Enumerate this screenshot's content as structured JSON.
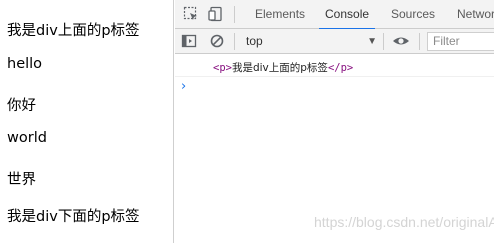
{
  "page": {
    "lines": [
      "我是div上面的p标签",
      "hello",
      "你好",
      "world",
      "世界",
      "我是div下面的p标签"
    ]
  },
  "devtools": {
    "tabs": [
      "Elements",
      "Console",
      "Sources",
      "Network"
    ],
    "active_tab": "Console",
    "console_toolbar": {
      "context": "top",
      "filter_placeholder": "Filter"
    },
    "log": {
      "open_tag": "<p>",
      "text": "我是div上面的p标签",
      "close_tag": "</p>"
    },
    "prompt_symbol": "›",
    "icons": [
      "inspect-element-icon",
      "device-toggle-icon",
      "sidebar-toggle-icon",
      "clear-console-icon",
      "dropdown-caret-icon",
      "eye-icon"
    ],
    "accent_color": "#1a73e8",
    "tag_color": "#881280"
  },
  "watermark": "https://blog.csdn.net/originalApril"
}
